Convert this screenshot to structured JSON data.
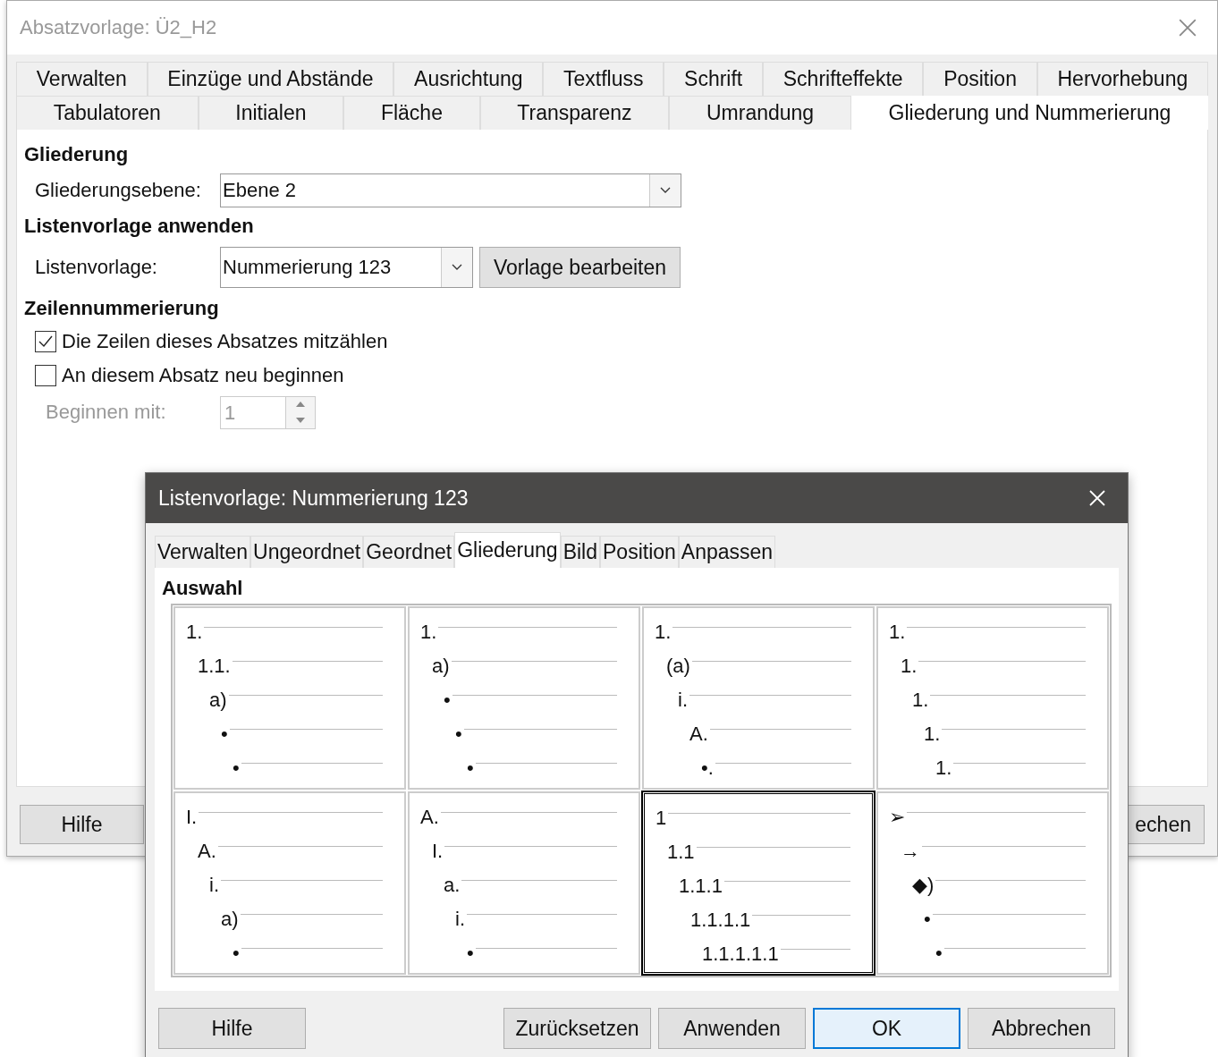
{
  "main_dialog": {
    "title": "Absatzvorlage: Ü2_H2",
    "tabs_row_1": [
      {
        "label": "Verwalten",
        "selected": false
      },
      {
        "label": "Einzüge und Abstände",
        "selected": false
      },
      {
        "label": "Ausrichtung",
        "selected": false
      },
      {
        "label": "Textfluss",
        "selected": false
      },
      {
        "label": "Schrift",
        "selected": false
      },
      {
        "label": "Schrifteffekte",
        "selected": false
      },
      {
        "label": "Position",
        "selected": false
      },
      {
        "label": "Hervorhebung",
        "selected": false
      }
    ],
    "tabs_row_2": [
      {
        "label": "Tabulatoren",
        "selected": false
      },
      {
        "label": "Initialen",
        "selected": false
      },
      {
        "label": "Fläche",
        "selected": false
      },
      {
        "label": "Transparenz",
        "selected": false
      },
      {
        "label": "Umrandung",
        "selected": false
      },
      {
        "label": "Gliederung und Nummerierung",
        "selected": true
      }
    ],
    "outline": {
      "heading": "Gliederung",
      "level_label": "Gliederungsebene:",
      "level_value": "Ebene 2"
    },
    "list_style": {
      "heading": "Listenvorlage anwenden",
      "label": "Listenvorlage:",
      "value": "Nummerierung 123",
      "edit_button": "Vorlage bearbeiten"
    },
    "line_numbering": {
      "heading": "Zeilennummerierung",
      "options": [
        {
          "label": "Die Zeilen dieses Absatzes mitzählen",
          "checked": true
        },
        {
          "label": "An diesem Absatz neu beginnen",
          "checked": false
        }
      ],
      "start_label": "Beginnen mit:",
      "start_value": "1",
      "disabled": true
    },
    "buttons": [
      {
        "label": "Hilfe"
      },
      {
        "label": "echen"
      }
    ]
  },
  "list_dialog": {
    "title": "Listenvorlage: Nummerierung 123",
    "tabs": [
      {
        "label": "Verwalten",
        "selected": false
      },
      {
        "label": "Ungeordnet",
        "selected": false
      },
      {
        "label": "Geordnet",
        "selected": false
      },
      {
        "label": "Gliederung",
        "selected": true
      },
      {
        "label": "Bild",
        "selected": false
      },
      {
        "label": "Position",
        "selected": false
      },
      {
        "label": "Anpassen",
        "selected": false
      }
    ],
    "section": "Auswahl",
    "presets": [
      {
        "selected": false,
        "levels": [
          "1.",
          "1.1.",
          "a)",
          "•",
          "•"
        ]
      },
      {
        "selected": false,
        "levels": [
          "1.",
          "a)",
          "•",
          "•",
          "•"
        ]
      },
      {
        "selected": false,
        "levels": [
          "1.",
          "(a)",
          "i.",
          "A.",
          "•."
        ]
      },
      {
        "selected": false,
        "levels": [
          "1.",
          "1.",
          "1.",
          "1.",
          "1."
        ]
      },
      {
        "selected": false,
        "levels": [
          "I.",
          "A.",
          "i.",
          "a)",
          "•"
        ]
      },
      {
        "selected": false,
        "levels": [
          "A.",
          "I.",
          "a.",
          "i.",
          "•"
        ]
      },
      {
        "selected": true,
        "levels": [
          "1",
          "1.1",
          "1.1.1",
          "1.1.1.1",
          "1.1.1.1.1"
        ]
      },
      {
        "selected": false,
        "levels": [
          "➢",
          "→",
          "◆)",
          "•",
          "•"
        ]
      }
    ],
    "buttons": [
      {
        "label": "Hilfe",
        "default": false
      },
      {
        "label": "Zurücksetzen",
        "default": false
      },
      {
        "label": "Anwenden",
        "default": false
      },
      {
        "label": "OK",
        "default": true
      },
      {
        "label": "Abbrechen",
        "default": false
      }
    ]
  }
}
